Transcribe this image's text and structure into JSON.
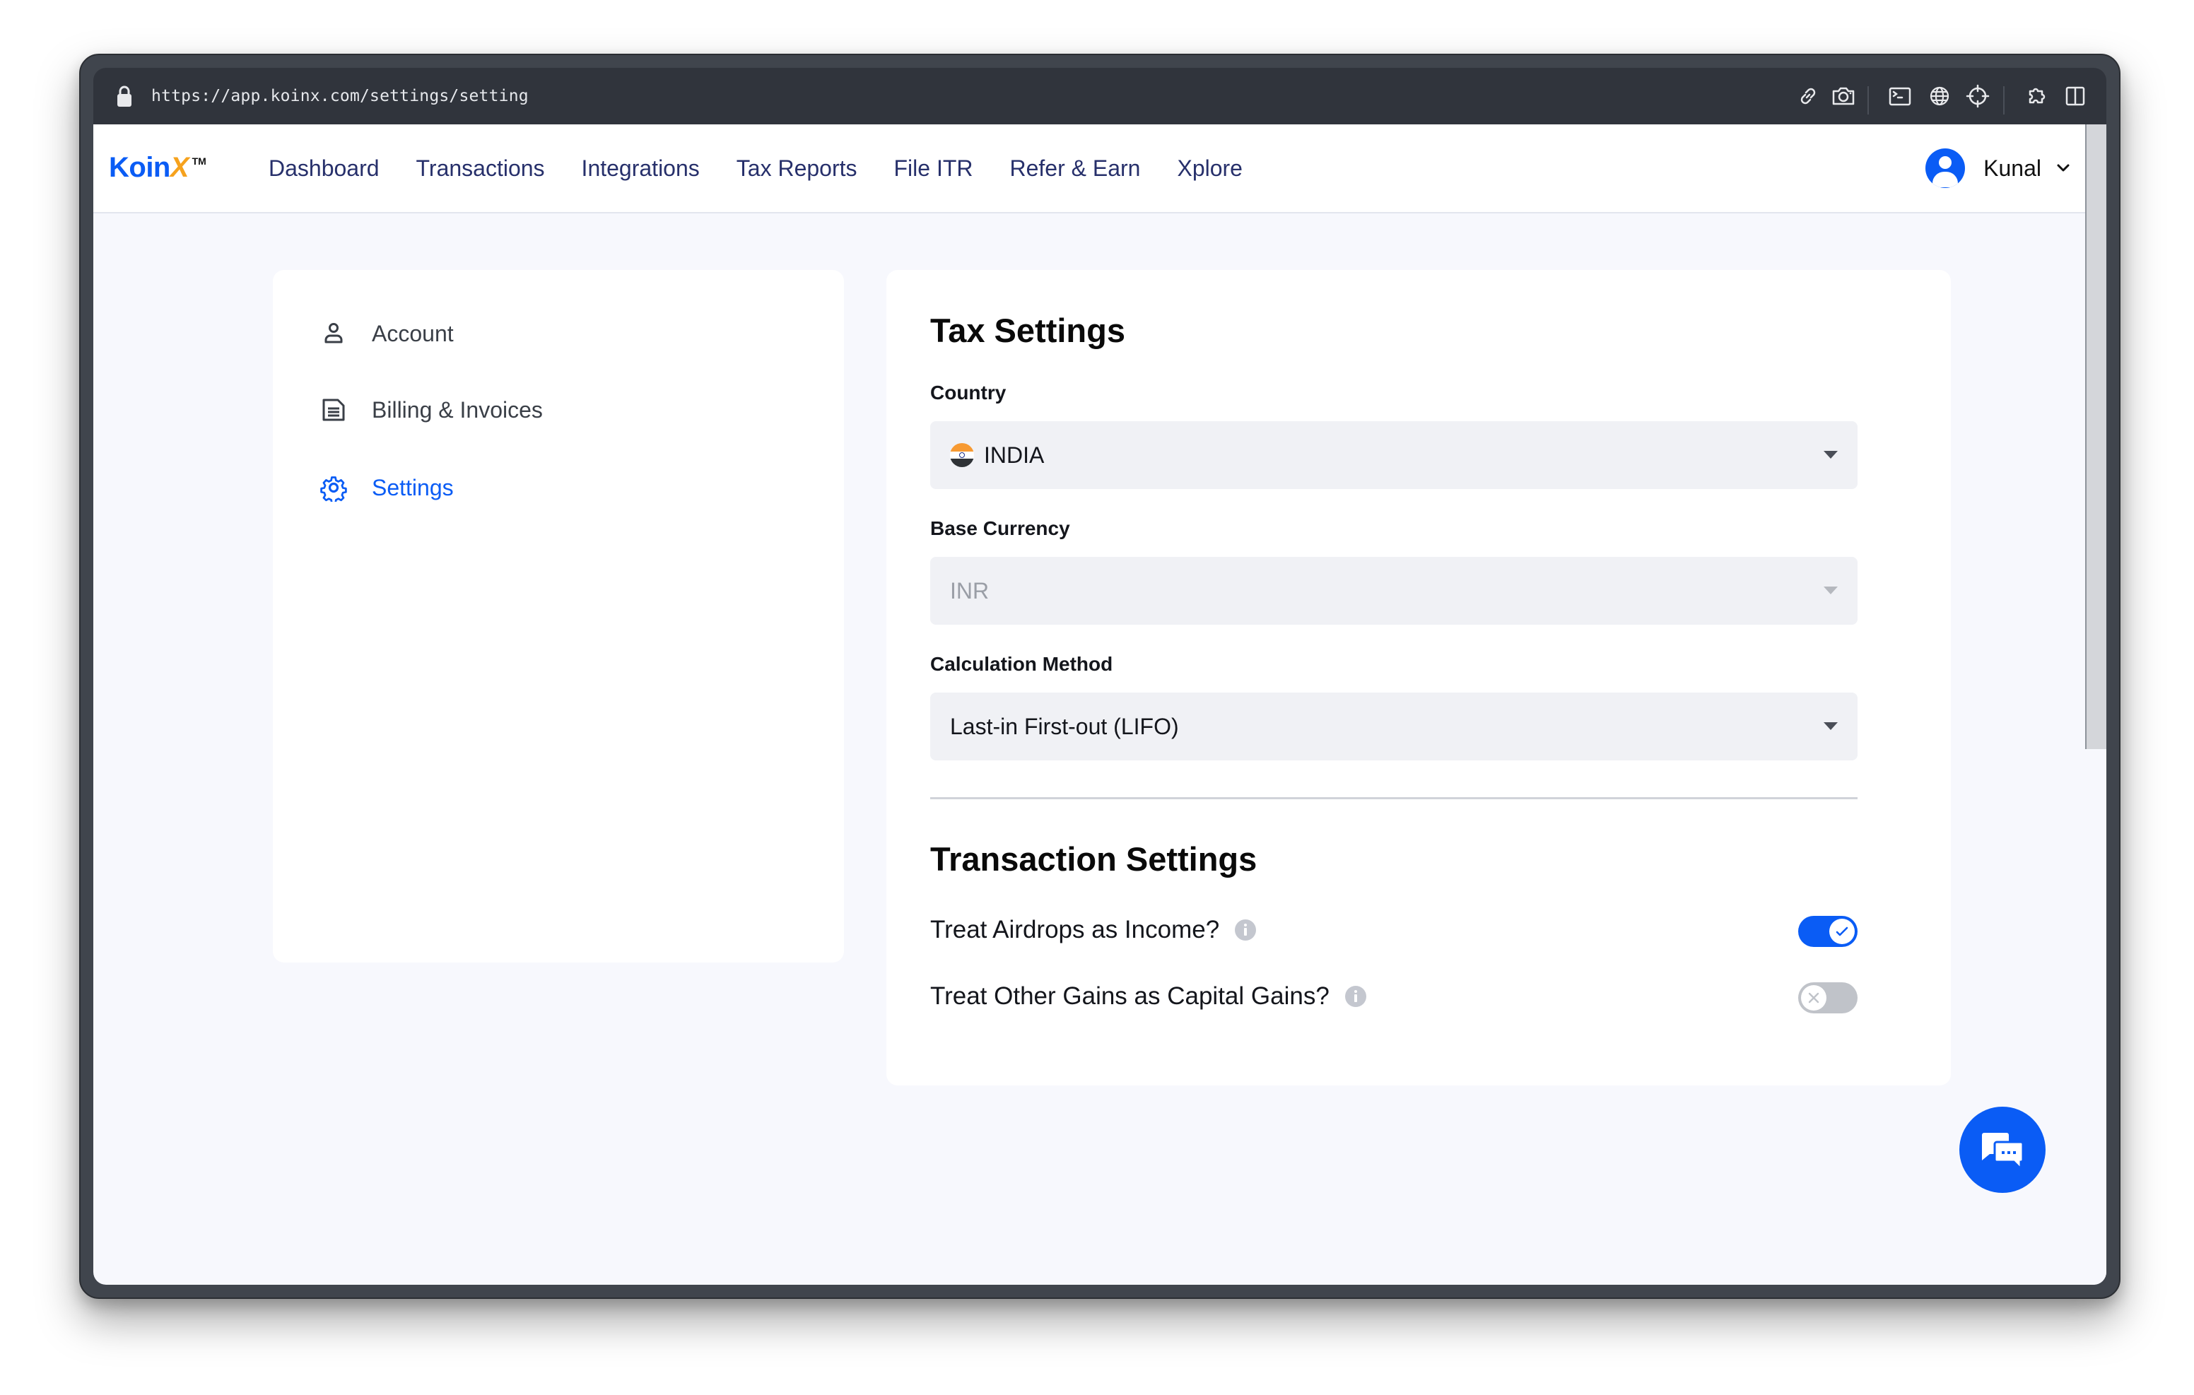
{
  "browser": {
    "url": "https://app.koinx.com/settings/setting",
    "toolbar_icons": [
      "link-icon",
      "camera-icon",
      "terminal-icon",
      "globe-icon",
      "crosshair-icon",
      "extension-icon",
      "split-view-icon"
    ]
  },
  "header": {
    "logo": {
      "text": "Koin",
      "accent": "X",
      "tm": "TM"
    },
    "nav": [
      "Dashboard",
      "Transactions",
      "Integrations",
      "Tax Reports",
      "File ITR",
      "Refer & Earn",
      "Xplore"
    ],
    "user": {
      "name": "Kunal"
    }
  },
  "sidebar": {
    "items": [
      {
        "label": "Account",
        "icon": "user-icon",
        "active": false
      },
      {
        "label": "Billing & Invoices",
        "icon": "document-icon",
        "active": false
      },
      {
        "label": "Settings",
        "icon": "gear-icon",
        "active": true
      }
    ]
  },
  "tax_settings": {
    "title": "Tax Settings",
    "country": {
      "label": "Country",
      "value": "INDIA",
      "flag": "india-flag"
    },
    "base_currency": {
      "label": "Base Currency",
      "value": "INR",
      "disabled": true
    },
    "calculation_method": {
      "label": "Calculation Method",
      "value": "Last-in First-out (LIFO)"
    }
  },
  "transaction_settings": {
    "title": "Transaction Settings",
    "toggles": [
      {
        "label": "Treat Airdrops as Income?",
        "enabled": true
      },
      {
        "label": "Treat Other Gains as Capital Gains?",
        "enabled": false
      }
    ]
  },
  "colors": {
    "accent": "#0a5cf5",
    "logo_accent": "#f6a21d",
    "nav_text": "#27306b",
    "page_bg": "#f7f8fd",
    "field_bg": "#f0f1f5",
    "toggle_off": "#c0c3c9"
  }
}
